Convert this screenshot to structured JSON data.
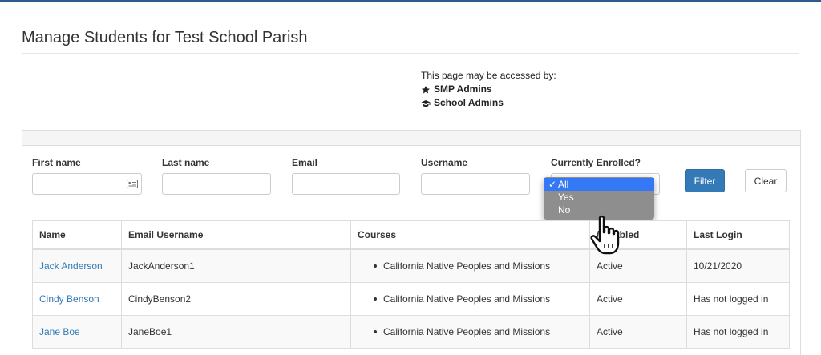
{
  "page": {
    "title": "Manage Students for Test School Parish",
    "access_note": "This page may be accessed by:",
    "access_roles": [
      {
        "icon": "star-icon",
        "label": "SMP Admins"
      },
      {
        "icon": "graduation-cap-icon",
        "label": "School Admins"
      }
    ]
  },
  "filters": {
    "first_name_label": "First name",
    "last_name_label": "Last name",
    "email_label": "Email",
    "username_label": "Username",
    "enrolled_label": "Currently Enrolled?",
    "enrolled_options": [
      "All",
      "Yes",
      "No"
    ],
    "enrolled_selected": "All",
    "filter_button": "Filter",
    "clear_button": "Clear"
  },
  "table": {
    "headers": [
      "Name",
      "Email Username",
      "Courses",
      "/Disabled",
      "Last Login"
    ],
    "rows": [
      {
        "name": "Jack Anderson",
        "username": "JackAnderson1",
        "course": "California Native Peoples and Missions",
        "status": "Active",
        "last_login": "10/21/2020"
      },
      {
        "name": "Cindy Benson",
        "username": "CindyBenson2",
        "course": "California Native Peoples and Missions",
        "status": "Active",
        "last_login": "Has not logged in"
      },
      {
        "name": "Jane Boe",
        "username": "JaneBoe1",
        "course": "California Native Peoples and Missions",
        "status": "Active",
        "last_login": "Has not logged in"
      }
    ]
  },
  "colors": {
    "link": "#337ab7",
    "primary_button": "#337ab7",
    "dropdown_selected": "#3478f6",
    "dropdown_bg": "#8e8e8e"
  }
}
